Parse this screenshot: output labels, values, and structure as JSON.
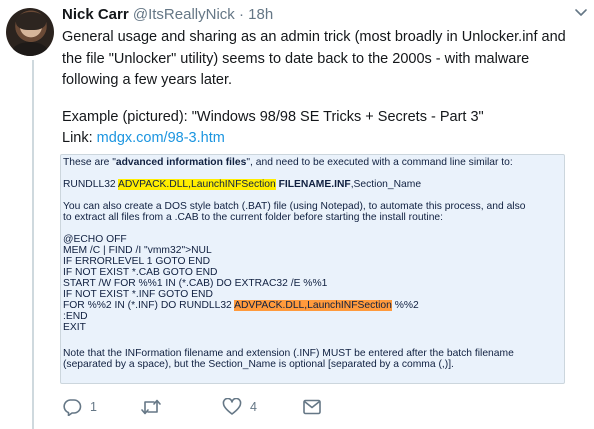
{
  "author": {
    "name": "Nick Carr",
    "handle": "@ItsReallyNick",
    "separator": "·",
    "time": "18h"
  },
  "tweet": {
    "paragraph1": "General usage and sharing as an admin trick (most broadly in Unlocker.inf and the file \"Unlocker\" utility) seems to date back to the 2000s - with malware following a few years later.",
    "example": "Example (pictured): \"Windows 98/98 SE Tricks + Secrets - Part 3\"",
    "link_prefix": "Link: ",
    "link_text": "mdgx.com/98-3.htm"
  },
  "card": {
    "intro_a": "These are \"",
    "intro_b": "advanced information files",
    "intro_c": "\", and need to be executed with a command line similar to:",
    "cmd_a": "RUNDLL32 ",
    "cmd_b": "ADVPACK.DLL,LaunchINFSection",
    "cmd_c": " ",
    "cmd_d": "FILENAME.INF",
    "cmd_e": ",Section_Name",
    "bat_1": "You can also create a DOS style batch (.BAT) file (using Notepad), to automate this process, and also",
    "bat_2": "to extract all files from a .CAB to the current folder before starting the install routine:",
    "code_1": "@ECHO OFF",
    "code_2": "MEM /C | FIND /I \"vmm32\">NUL",
    "code_3": "IF ERRORLEVEL 1 GOTO END",
    "code_4": "IF NOT EXIST *.CAB GOTO END",
    "code_5": "START /W FOR %%1 IN (*.CAB) DO EXTRAC32 /E %%1",
    "code_6": "IF NOT EXIST *.INF GOTO END",
    "code_7a": "FOR %%2 IN (*.INF) DO RUNDLL32 ",
    "code_7b": "ADVPACK.DLL,LaunchINFSection",
    "code_7c": " %%2",
    "code_8": ":END",
    "code_9": "EXIT",
    "note_1": "Note that the INFormation filename and extension (.INF) MUST be entered after the batch filename",
    "note_2": "(separated by a space), but the Section_Name is optional [separated by a comma (,)].",
    "highlight_yellow": "#ffee00",
    "highlight_orange": "#ff9a3c"
  },
  "actions": {
    "reply_count": "1",
    "retweet_count": "",
    "like_count": "4",
    "icons": [
      "reply-icon",
      "retweet-icon",
      "like-icon",
      "direct-message-icon"
    ]
  }
}
